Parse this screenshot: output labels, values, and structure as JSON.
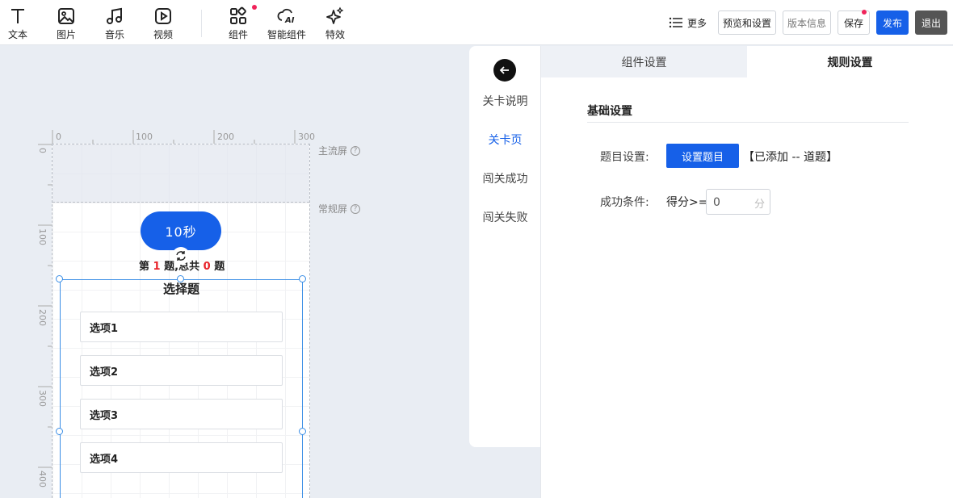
{
  "toolbar": {
    "tools": [
      {
        "label": "文本",
        "icon": "text-icon"
      },
      {
        "label": "图片",
        "icon": "image-icon"
      },
      {
        "label": "音乐",
        "icon": "music-icon"
      },
      {
        "label": "视频",
        "icon": "video-icon"
      },
      {
        "label": "组件",
        "icon": "component-icon"
      },
      {
        "label": "智能组件",
        "icon": "ai-component-icon"
      },
      {
        "label": "特效",
        "icon": "sparkle-icon"
      }
    ],
    "more_label": "更多",
    "preview_label": "预览和设置",
    "version_label": "版本信息",
    "save_label": "保存",
    "publish_label": "发布",
    "exit_label": "退出",
    "accent_color": "#1660e8",
    "badge_color": "#f0235a"
  },
  "canvas": {
    "ruler_h": [
      "0",
      "100",
      "200",
      "300"
    ],
    "ruler_v": [
      "0",
      "100",
      "200",
      "300",
      "400"
    ],
    "main_screen_label": "主流屏",
    "normal_screen_label": "常规屏",
    "help_mark": "?",
    "timer_text": "10秒",
    "progress": {
      "prefix": "第",
      "current": "1",
      "middle": "题,总共",
      "total": "0",
      "suffix": "题"
    },
    "question": {
      "title": "选择题",
      "options": [
        "选项1",
        "选项2",
        "选项3",
        "选项4"
      ]
    }
  },
  "sidenav": {
    "items": [
      "关卡说明",
      "关卡页",
      "闯关成功",
      "闯关失败"
    ],
    "active_index": 1
  },
  "panel": {
    "tabs": [
      "组件设置",
      "规则设置"
    ],
    "active_tab": 1,
    "section_title": "基础设置",
    "question_setting_label": "题目设置:",
    "set_question_button": "设置题目",
    "added_text": "【已添加 -- 道题】",
    "success_condition_label": "成功条件:",
    "score_prefix": "得分>=",
    "score_value": "0",
    "score_unit": "分"
  }
}
